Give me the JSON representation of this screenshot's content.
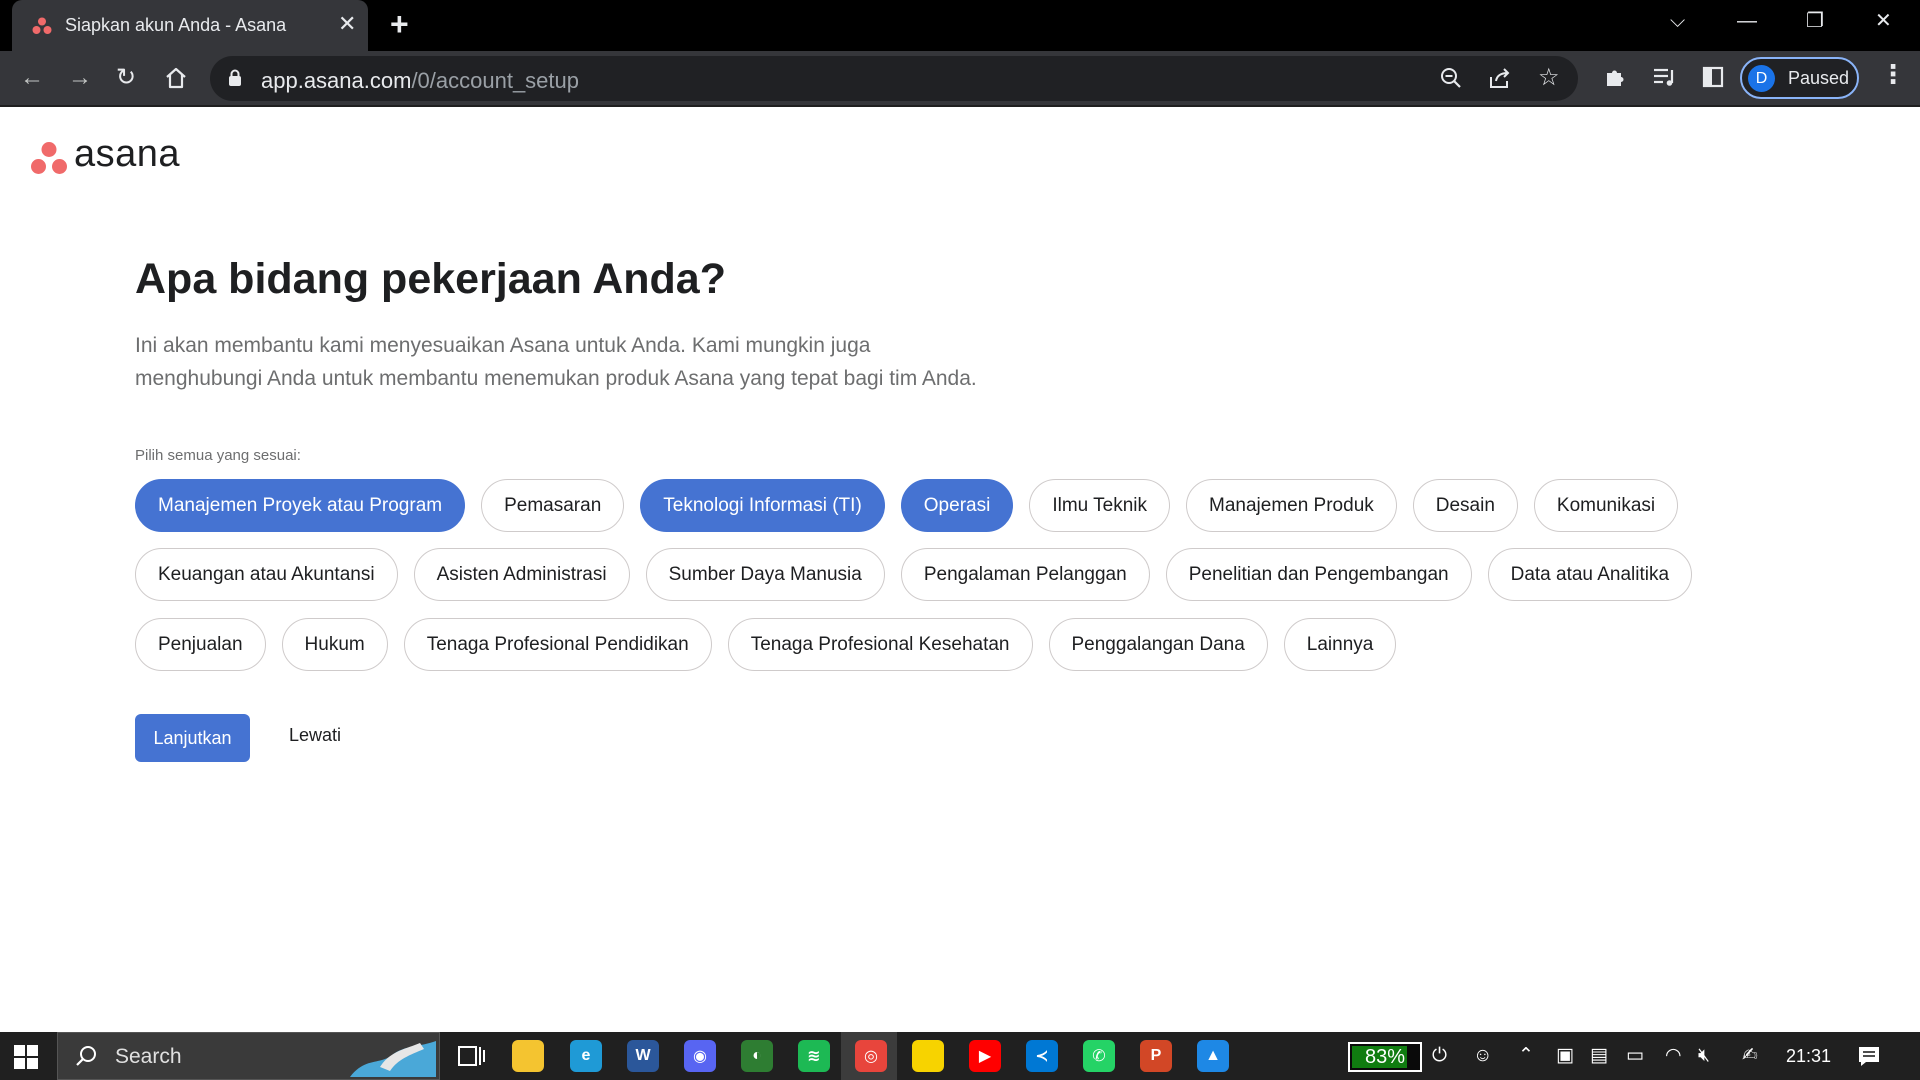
{
  "browser": {
    "tab": {
      "title": "Siapkan akun Anda - Asana",
      "close_glyph": "✕"
    },
    "new_tab_glyph": "+",
    "window_controls": {
      "dropdown": "⌵",
      "minimize": "—",
      "restore": "❐",
      "close": "✕"
    },
    "url": {
      "domain": "app.asana.com",
      "path": "/0/account_setup"
    },
    "profile": {
      "initial": "D",
      "status": "Paused"
    }
  },
  "page": {
    "logo": {
      "text": "asana",
      "dot_color": "#f06a6a"
    },
    "heading": "Apa bidang pekerjaan Anda?",
    "subtext": [
      "Ini akan membantu kami menyesuaikan Asana untuk Anda. Kami mungkin juga",
      "menghubungi Anda untuk membantu menemukan produk Asana yang tepat bagi tim Anda."
    ],
    "pick_label": "Pilih semua yang sesuai:",
    "chip_rows": [
      [
        {
          "label": "Manajemen Proyek atau Program",
          "selected": true
        },
        {
          "label": "Pemasaran",
          "selected": false
        },
        {
          "label": "Teknologi Informasi (TI)",
          "selected": true
        },
        {
          "label": "Operasi",
          "selected": true
        },
        {
          "label": "Ilmu Teknik",
          "selected": false
        },
        {
          "label": "Manajemen Produk",
          "selected": false
        },
        {
          "label": "Desain",
          "selected": false
        },
        {
          "label": "Komunikasi",
          "selected": false
        }
      ],
      [
        {
          "label": "Keuangan atau Akuntansi",
          "selected": false
        },
        {
          "label": "Asisten Administrasi",
          "selected": false
        },
        {
          "label": "Sumber Daya Manusia",
          "selected": false
        },
        {
          "label": "Pengalaman Pelanggan",
          "selected": false
        },
        {
          "label": "Penelitian dan Pengembangan",
          "selected": false
        },
        {
          "label": "Data atau Analitika",
          "selected": false
        }
      ],
      [
        {
          "label": "Penjualan",
          "selected": false
        },
        {
          "label": "Hukum",
          "selected": false
        },
        {
          "label": "Tenaga Profesional Pendidikan",
          "selected": false
        },
        {
          "label": "Tenaga Profesional Kesehatan",
          "selected": false
        },
        {
          "label": "Penggalangan Dana",
          "selected": false
        },
        {
          "label": "Lainnya",
          "selected": false
        }
      ]
    ],
    "continue_label": "Lanjutkan",
    "skip_label": "Lewati",
    "accent_color": "#4573d2"
  },
  "taskbar": {
    "search_label": "Search",
    "apps": [
      {
        "name": "file-explorer",
        "glyph": "",
        "color": "#f4c430"
      },
      {
        "name": "edge",
        "glyph": "e",
        "color": "#1f9ad6"
      },
      {
        "name": "word",
        "glyph": "W",
        "color": "#2b579a"
      },
      {
        "name": "discord",
        "glyph": "◉",
        "color": "#5865f2"
      },
      {
        "name": "photos",
        "glyph": "◐",
        "color": "#2e7d32"
      },
      {
        "name": "spotify",
        "glyph": "≋",
        "color": "#1db954"
      },
      {
        "name": "chrome",
        "glyph": "◎",
        "color": "#e8453c"
      },
      {
        "name": "sticky-notes",
        "glyph": "",
        "color": "#f7d300"
      },
      {
        "name": "youtube",
        "glyph": "▶",
        "color": "#ff0000"
      },
      {
        "name": "vscode",
        "glyph": "≺",
        "color": "#0078d4"
      },
      {
        "name": "whatsapp",
        "glyph": "✆",
        "color": "#25d366"
      },
      {
        "name": "powerpoint",
        "glyph": "P",
        "color": "#d24726"
      },
      {
        "name": "image-viewer",
        "glyph": "▲",
        "color": "#1e88e5"
      }
    ],
    "battery_text": "83%",
    "battery_level": 0.83,
    "clock": "21:31"
  }
}
